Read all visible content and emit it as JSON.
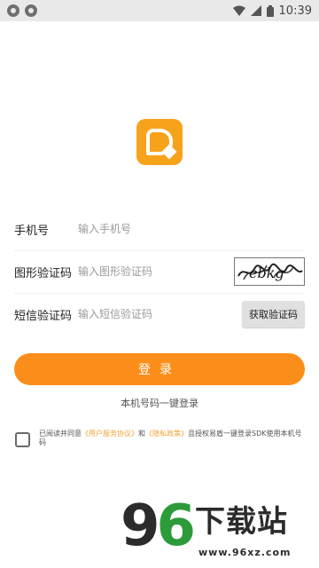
{
  "status_bar": {
    "time": "10:39",
    "icons": [
      "circle-icon",
      "circle-icon",
      "wifi-icon",
      "signal-icon",
      "battery-icon"
    ]
  },
  "logo": {
    "icon": "app-logo-icon",
    "color": "#f7a21b"
  },
  "form": {
    "phone": {
      "label": "手机号",
      "placeholder": "输入手机号",
      "value": ""
    },
    "captcha": {
      "label": "图形验证码",
      "placeholder": "输入图形验证码",
      "value": "",
      "image_text": "ebkg"
    },
    "sms": {
      "label": "短信验证码",
      "placeholder": "输入短信验证码",
      "value": "",
      "button_label": "获取验证码"
    }
  },
  "login_button": {
    "label": "登录",
    "color": "#fb8e1a"
  },
  "one_tap_login": "本机号码一键登录",
  "agreement": {
    "checked": false,
    "prefix": "已阅读并同意",
    "user_agreement": "《用户服务协议》",
    "and": "和",
    "privacy_policy": "《隐私政策》",
    "suffix": "且授权易盾一键登录SDK使用本机号码",
    "link_color": "#f3a23a"
  },
  "watermark": {
    "digits_dark": "9",
    "digits_green": "6",
    "title": "下载站",
    "url": "www.96xz.com"
  }
}
